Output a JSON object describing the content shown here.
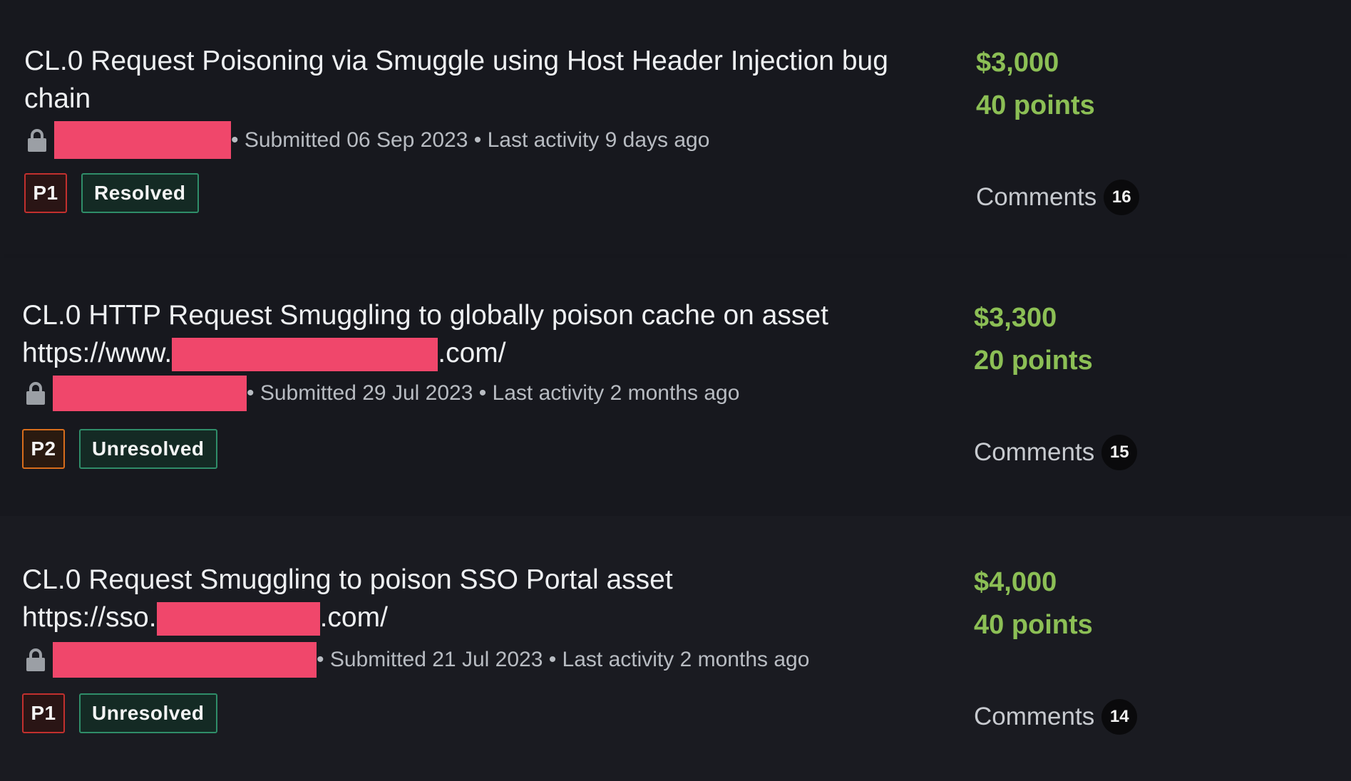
{
  "reports": [
    {
      "title_line1": "CL.0 Request Poisoning via Smuggle using Host Header Injection bug",
      "title_line2": "chain",
      "meta": "• Submitted 06 Sep 2023 • Last activity 9 days ago",
      "priority": "P1",
      "state": "Resolved",
      "bounty": "$3,000",
      "points": "40 points",
      "comments_label": "Comments",
      "comments_count": "16"
    },
    {
      "title_line1": "CL.0 HTTP Request Smuggling to globally poison cache on asset",
      "title_line2_prefix": "https://www.",
      "title_line2_suffix": ".com/",
      "meta": "• Submitted 29 Jul 2023 • Last activity 2 months ago",
      "priority": "P2",
      "state": "Unresolved",
      "bounty": "$3,300",
      "points": "20 points",
      "comments_label": "Comments",
      "comments_count": "15"
    },
    {
      "title_line1": "CL.0 Request Smuggling to poison SSO Portal asset",
      "title_line2_prefix": "https://sso.",
      "title_line2_suffix": ".com/",
      "meta": "• Submitted 21 Jul 2023 • Last activity 2 months ago",
      "priority": "P1",
      "state": "Unresolved",
      "bounty": "$4,000",
      "points": "40 points",
      "comments_label": "Comments",
      "comments_count": "14"
    }
  ],
  "colors": {
    "background": "#17181e",
    "redaction": "#f0476b",
    "reward": "#8cbf55",
    "p1_border": "#c2302e",
    "p2_border": "#d86d1c",
    "state_border": "#2f8d69"
  },
  "icons": {
    "lock": "lock-icon"
  }
}
